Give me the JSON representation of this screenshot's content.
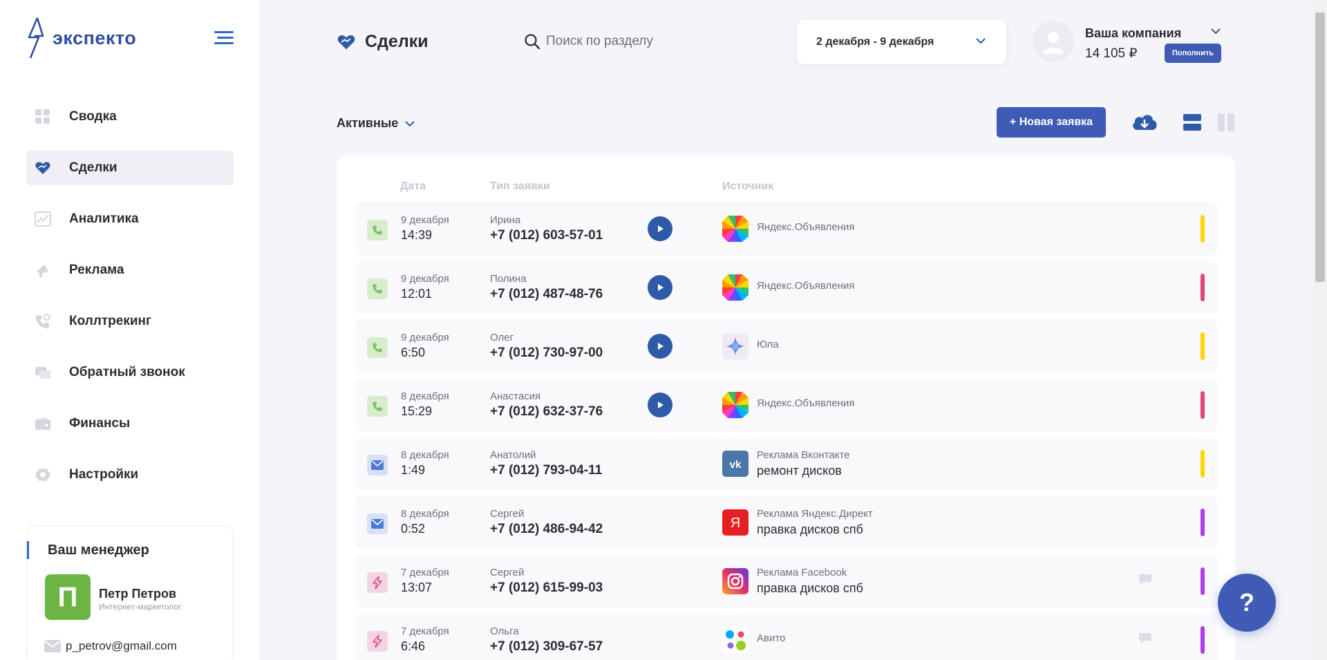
{
  "brand": {
    "logo_text": "экспекто"
  },
  "sidebar": {
    "items": [
      {
        "label": "Сводка",
        "icon": "dashboard-icon"
      },
      {
        "label": "Сделки",
        "icon": "heart-handshake-icon",
        "active": true
      },
      {
        "label": "Аналитика",
        "icon": "analytics-icon"
      },
      {
        "label": "Реклама",
        "icon": "megaphone-icon"
      },
      {
        "label": "Коллтрекинг",
        "icon": "phone-tracking-icon"
      },
      {
        "label": "Обратный звонок",
        "icon": "callback-icon"
      },
      {
        "label": "Финансы",
        "icon": "wallet-icon"
      },
      {
        "label": "Настройки",
        "icon": "gear-icon"
      }
    ],
    "manager": {
      "title": "Ваш менеджер",
      "initial": "П",
      "name": "Петр Петров",
      "role": "Интернет-маркетолог",
      "email": "p_petrov@gmail.com"
    }
  },
  "header": {
    "title": "Сделки",
    "search_placeholder": "Поиск по разделу",
    "date_range": "2 декабря - 9 декабря",
    "company_name": "Ваша компания",
    "balance": "14 105 ₽",
    "topup_label": "Пополнить"
  },
  "toolbar": {
    "filter_label": "Активные",
    "new_request_label": "+ Новая заявка"
  },
  "table": {
    "columns": {
      "date": "Дата",
      "type": "Тип заявки",
      "source": "Источник"
    },
    "rows": [
      {
        "type": "call",
        "date": "9 декабря",
        "time": "14:39",
        "name": "Ирина",
        "phone": "+7 (012) 603-57-01",
        "has_audio": true,
        "source_logo": "yandex-ads",
        "source": "Яндекс.Объявления",
        "campaign": "",
        "has_comment": false,
        "status_color": "#ffd600"
      },
      {
        "type": "call",
        "date": "9 декабря",
        "time": "12:01",
        "name": "Полина",
        "phone": "+7 (012) 487-48-76",
        "has_audio": true,
        "source_logo": "yandex-ads",
        "source": "Яндекс.Объявления",
        "campaign": "",
        "has_comment": false,
        "status_color": "#e6417a"
      },
      {
        "type": "call",
        "date": "9 декабря",
        "time": "6:50",
        "name": "Олег",
        "phone": "+7 (012) 730-97-00",
        "has_audio": true,
        "source_logo": "youla",
        "source": "Юла",
        "campaign": "",
        "has_comment": false,
        "status_color": "#ffd600"
      },
      {
        "type": "call",
        "date": "8 декабря",
        "time": "15:29",
        "name": "Анастасия",
        "phone": "+7 (012) 632-37-76",
        "has_audio": true,
        "source_logo": "yandex-ads",
        "source": "Яндекс.Объявления",
        "campaign": "",
        "has_comment": false,
        "status_color": "#e6417a"
      },
      {
        "type": "mail",
        "date": "8 декабря",
        "time": "1:49",
        "name": "Анатолий",
        "phone": "+7 (012) 793-04-11",
        "has_audio": false,
        "source_logo": "vk",
        "source": "Реклама Вконтакте",
        "campaign": "ремонт дисков",
        "has_comment": false,
        "status_color": "#ffd600"
      },
      {
        "type": "mail",
        "date": "8 декабря",
        "time": "0:52",
        "name": "Сергей",
        "phone": "+7 (012) 486-94-42",
        "has_audio": false,
        "source_logo": "yandex-direct",
        "source": "Реклама Яндекс.Директ",
        "campaign": "правка дисков спб",
        "has_comment": false,
        "status_color": "#b03ef0"
      },
      {
        "type": "bolt",
        "date": "7 декабря",
        "time": "13:07",
        "name": "Сергей",
        "phone": "+7 (012) 615-99-03",
        "has_audio": false,
        "source_logo": "instagram",
        "source": "Реклама Facebook",
        "campaign": "правка дисков спб",
        "has_comment": true,
        "status_color": "#b03ef0"
      },
      {
        "type": "bolt",
        "date": "7 декабря",
        "time": "6:46",
        "name": "Ольга",
        "phone": "+7 (012) 309-67-57",
        "has_audio": false,
        "source_logo": "avito",
        "source": "Авито",
        "campaign": "",
        "has_comment": true,
        "status_color": "#b03ef0"
      }
    ]
  },
  "help": {
    "label": "?"
  },
  "colors": {
    "accent": "#3f5bb5",
    "brand_blue": "#2f4f9e",
    "page_bg": "#f5f5f9"
  }
}
